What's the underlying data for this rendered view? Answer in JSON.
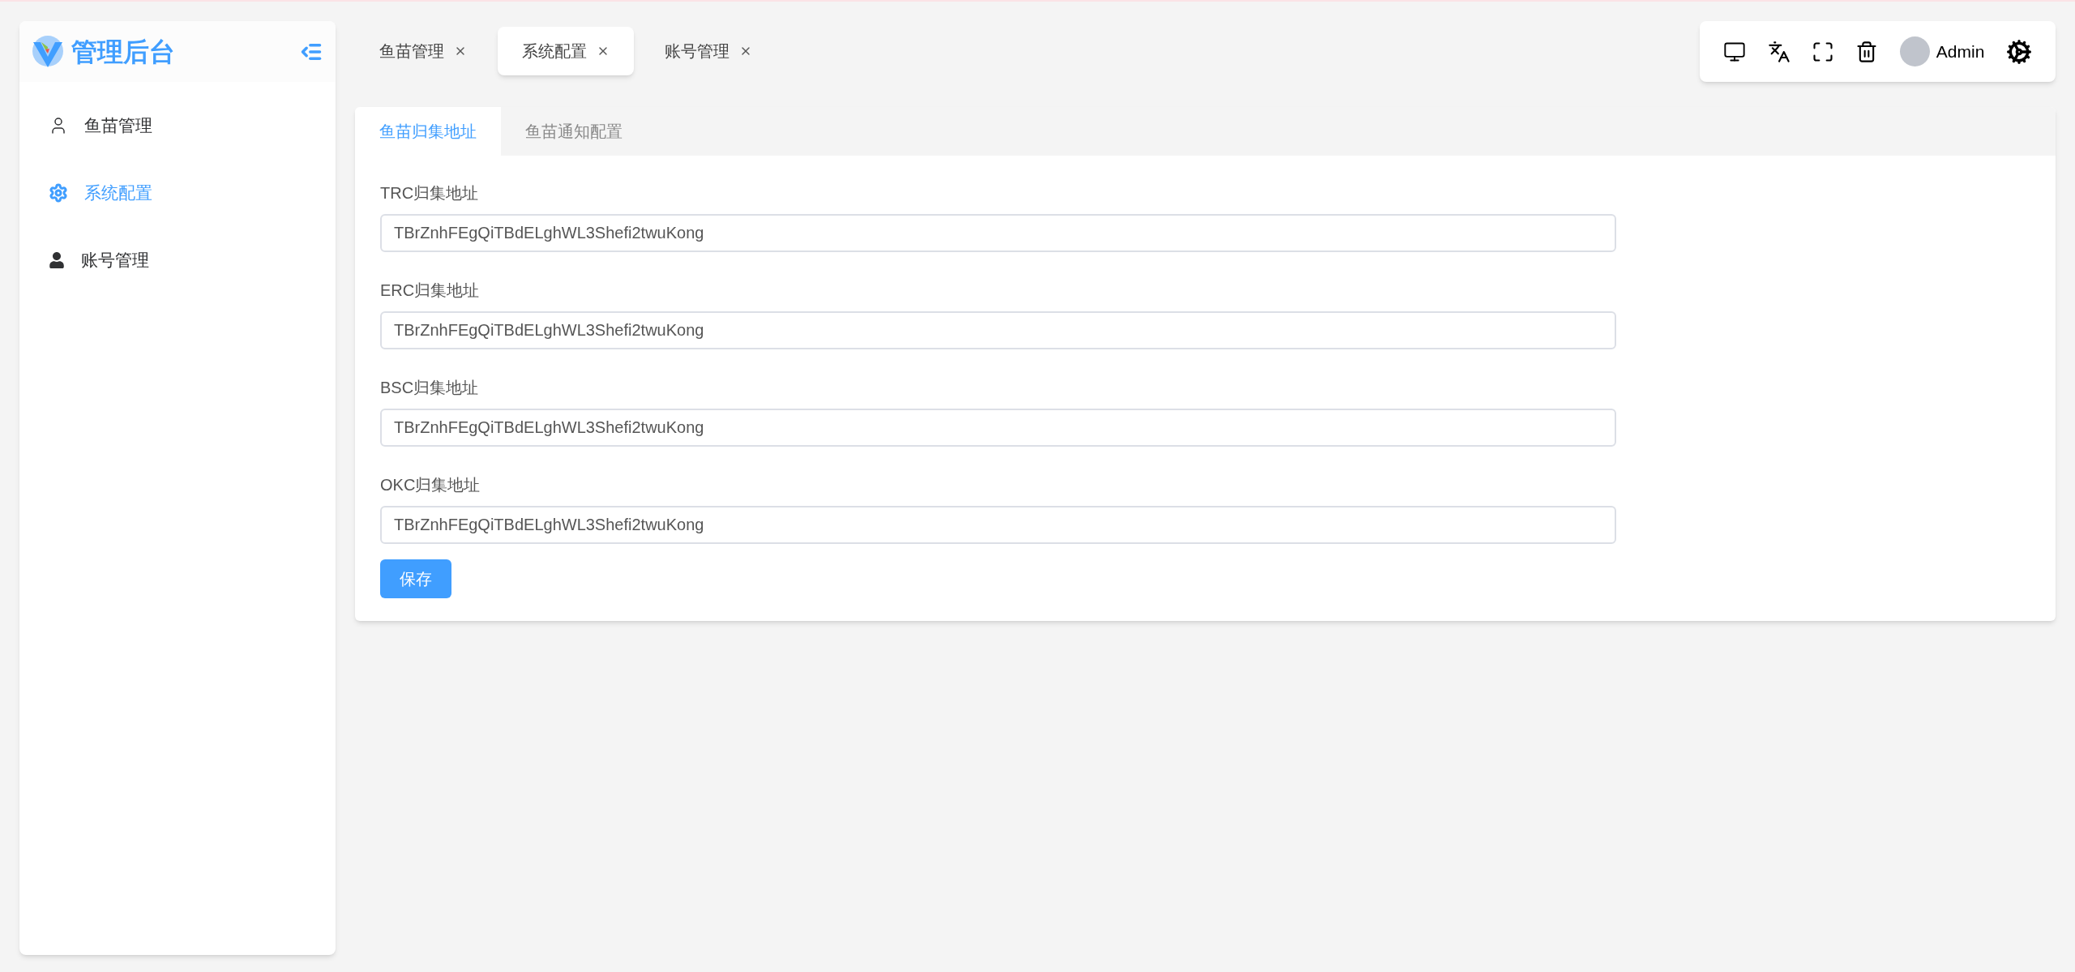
{
  "sidebar": {
    "title": "管理后台",
    "items": [
      {
        "label": "鱼苗管理",
        "selected": false
      },
      {
        "label": "系统配置",
        "selected": true
      },
      {
        "label": "账号管理",
        "selected": false
      }
    ]
  },
  "tabs": [
    {
      "label": "鱼苗管理",
      "selected": false
    },
    {
      "label": "系统配置",
      "selected": true
    },
    {
      "label": "账号管理",
      "selected": false
    }
  ],
  "toolbar": {
    "user": "Admin"
  },
  "panel": {
    "tabs": [
      {
        "label": "鱼苗归集地址",
        "selected": true
      },
      {
        "label": "鱼苗通知配置",
        "selected": false
      }
    ],
    "fields": [
      {
        "label": "TRC归集地址",
        "value": "TBrZnhFEgQiTBdELghWL3Shefi2twuKong"
      },
      {
        "label": "ERC归集地址",
        "value": "TBrZnhFEgQiTBdELghWL3Shefi2twuKong"
      },
      {
        "label": "BSC归集地址",
        "value": "TBrZnhFEgQiTBdELghWL3Shefi2twuKong"
      },
      {
        "label": "OKC归集地址",
        "value": "TBrZnhFEgQiTBdELghWL3Shefi2twuKong"
      }
    ],
    "save_button": "保存"
  }
}
